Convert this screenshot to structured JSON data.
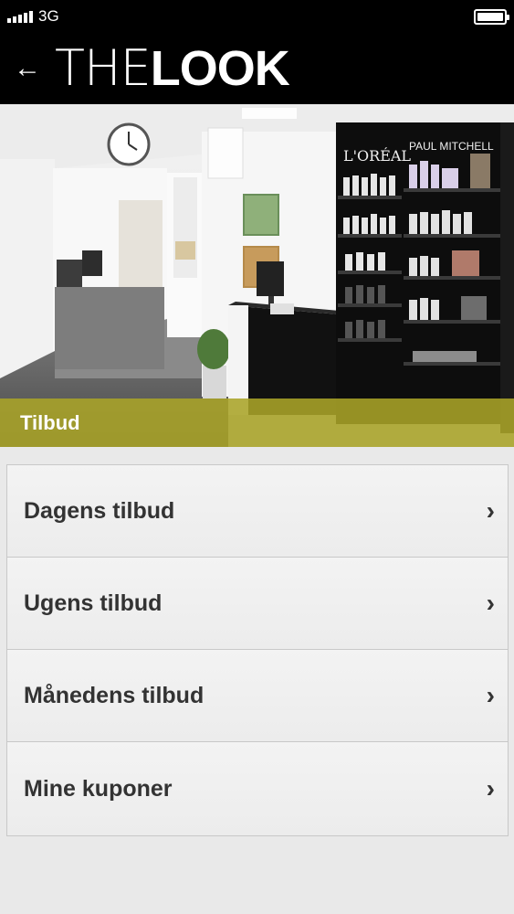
{
  "status_bar": {
    "network": "3G"
  },
  "header": {
    "logo_the": "THE",
    "logo_look": "LOOK",
    "back_icon": "←"
  },
  "section": {
    "title": "Tilbud"
  },
  "menu": {
    "items": [
      {
        "label": "Dagens tilbud",
        "chevron": "›"
      },
      {
        "label": "Ugens tilbud",
        "chevron": "›"
      },
      {
        "label": "Månedens tilbud",
        "chevron": "›"
      },
      {
        "label": "Mine kuponer",
        "chevron": "›"
      }
    ]
  },
  "hero_image": {
    "shelf_labels": [
      "L'ORÉAL",
      "PAUL MITCHELL"
    ]
  },
  "colors": {
    "accent": "#aaa428",
    "header_bg": "#000000",
    "background": "#e9e9e9"
  }
}
